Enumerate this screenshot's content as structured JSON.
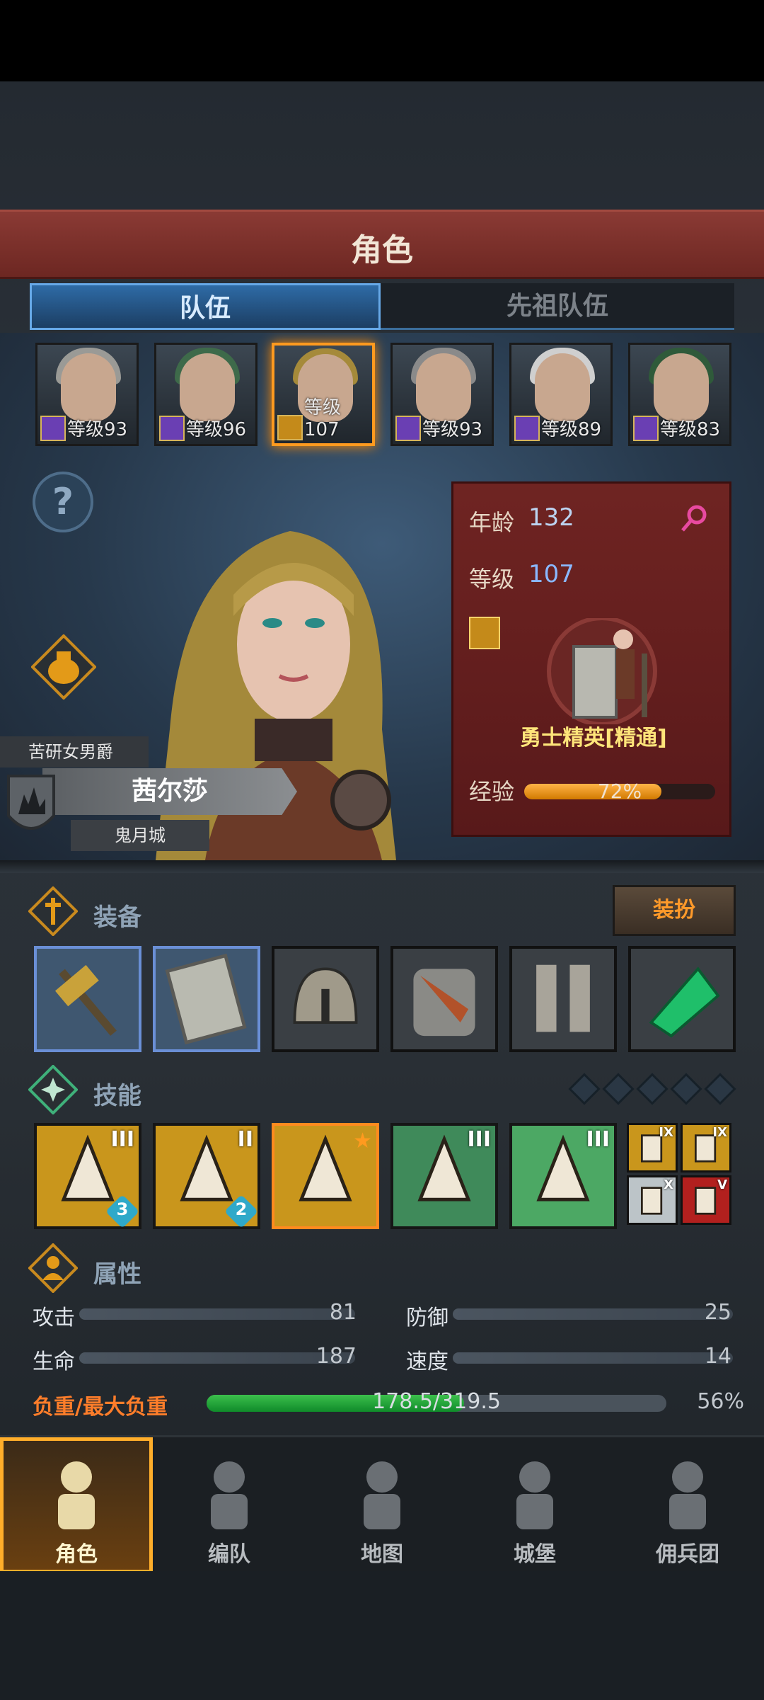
{
  "header": {
    "title": "角色"
  },
  "tabs": {
    "team": "队伍",
    "ancestor": "先祖队伍"
  },
  "roster": [
    {
      "level": "等级93",
      "hair": "#9a9a96",
      "badge": "purple"
    },
    {
      "level": "等级96",
      "hair": "#3e6a4a",
      "badge": "purple"
    },
    {
      "level": "等级107",
      "hair": "#a58a3a",
      "badge": "gold",
      "selected": true
    },
    {
      "level": "等级93",
      "hair": "#8a8a8a",
      "badge": "purple"
    },
    {
      "level": "等级89",
      "hair": "#cfcfcf",
      "badge": "purple"
    },
    {
      "level": "等级83",
      "hair": "#2f5a3a",
      "badge": "purple"
    }
  ],
  "character": {
    "title": "苦研女男爵",
    "name": "茜尔莎",
    "city": "鬼月城",
    "age_label": "年龄",
    "age": "132",
    "level_label": "等级",
    "level": "107",
    "class_name": "勇士精英[精通]",
    "exp_label": "经验",
    "exp_percent": "72%",
    "exp_fraction": 0.72
  },
  "equipment": {
    "label": "装备",
    "dress_button": "装扮",
    "slots": [
      "hammer-icon",
      "shield-icon",
      "helmet-icon",
      "armor-icon",
      "boots-icon",
      "emerald-icon"
    ]
  },
  "skills": {
    "label": "技能",
    "slots": [
      {
        "icon": "sword-shield-skill-icon",
        "rank": "III",
        "count": "3",
        "bg": "#c9961c"
      },
      {
        "icon": "shatter-skill-icon",
        "rank": "II",
        "count": "2",
        "bg": "#c9961c"
      },
      {
        "icon": "slash-skill-icon",
        "rank": "",
        "count": "",
        "bg": "#c9961c",
        "selected": true
      },
      {
        "icon": "burst-skill-icon",
        "rank": "III",
        "count": "",
        "bg": "#3f8a5a"
      },
      {
        "icon": "crystal-skill-icon",
        "rank": "III",
        "count": "",
        "bg": "#4ca864"
      }
    ],
    "small": [
      {
        "icon": "coffin-icon",
        "rank": "IX",
        "bg": "#c9961c"
      },
      {
        "icon": "coffin-icon",
        "rank": "IX",
        "bg": "#c9961c"
      },
      {
        "icon": "hand-shield-icon",
        "rank": "X",
        "bg": "#bcc4c8"
      },
      {
        "icon": "heart-icon",
        "rank": "V",
        "bg": "#b2201e"
      }
    ]
  },
  "attributes": {
    "label": "属性",
    "attack_label": "攻击",
    "attack": "81",
    "defense_label": "防御",
    "defense": "25",
    "hp_label": "生命",
    "hp": "187",
    "speed_label": "速度",
    "speed": "14",
    "load_label": "负重/最大负重",
    "load_value": "178.5/319.5",
    "load_percent": "56%",
    "load_fraction": 0.56
  },
  "nav": [
    {
      "label": "角色",
      "icon": "knight-icon",
      "active": true
    },
    {
      "label": "编队",
      "icon": "helmet-team-icon"
    },
    {
      "label": "地图",
      "icon": "compass-map-icon"
    },
    {
      "label": "城堡",
      "icon": "castle-icon"
    },
    {
      "label": "佣兵团",
      "icon": "mercenary-icon"
    }
  ],
  "colors": {
    "accent": "#ff9a1f",
    "banner": "#7a2e29",
    "tab_active": "#2e6ba6"
  }
}
